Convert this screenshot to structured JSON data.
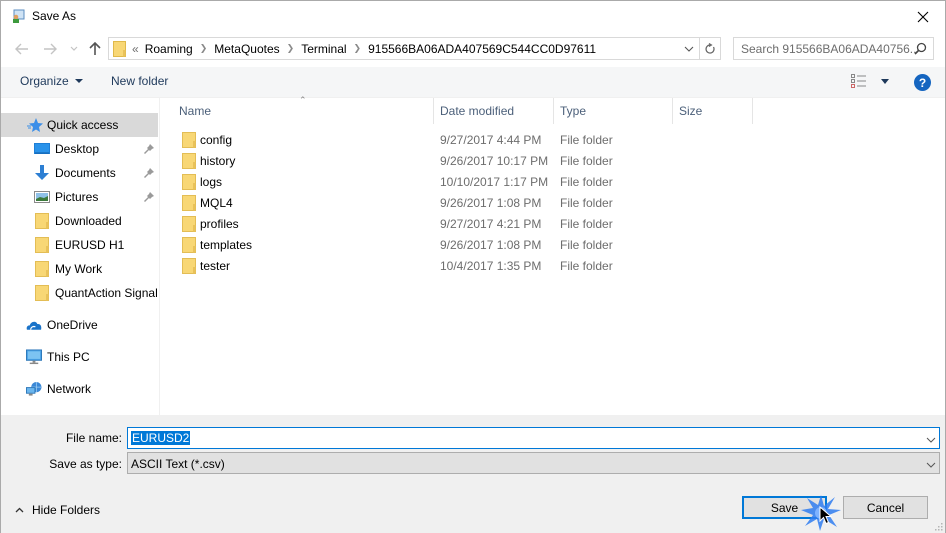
{
  "window": {
    "title": "Save As",
    "close_label": "Close"
  },
  "navigation": {
    "back_label": "Back",
    "forward_label": "Forward",
    "recent_label": "Recent locations",
    "up_label": "Up",
    "breadcrumb_overflow": "«",
    "breadcrumbs": [
      "Roaming",
      "MetaQuotes",
      "Terminal",
      "915566BA06ADA407569C544CC0D97611"
    ],
    "search_placeholder": "Search 915566BA06ADA40756..."
  },
  "toolbar": {
    "organize_label": "Organize",
    "new_folder_label": "New folder",
    "help_label": "?"
  },
  "sidebar": {
    "items": [
      {
        "label": "Quick access",
        "icon": "star-icon",
        "selected": true,
        "pinned": false
      },
      {
        "label": "Desktop",
        "icon": "desktop-icon",
        "selected": false,
        "pinned": true
      },
      {
        "label": "Documents",
        "icon": "download-arrow-icon",
        "selected": false,
        "pinned": true
      },
      {
        "label": "Pictures",
        "icon": "pictures-icon",
        "selected": false,
        "pinned": true
      },
      {
        "label": "Downloaded",
        "icon": "folder-icon",
        "selected": false,
        "pinned": false
      },
      {
        "label": "EURUSD H1",
        "icon": "folder-icon",
        "selected": false,
        "pinned": false
      },
      {
        "label": "My Work",
        "icon": "folder-icon",
        "selected": false,
        "pinned": false
      },
      {
        "label": "QuantAction Signal",
        "icon": "folder-icon",
        "selected": false,
        "pinned": false
      },
      {
        "label": "OneDrive",
        "icon": "cloud-icon",
        "selected": false,
        "pinned": false
      },
      {
        "label": "This PC",
        "icon": "computer-icon",
        "selected": false,
        "pinned": false
      },
      {
        "label": "Network",
        "icon": "network-icon",
        "selected": false,
        "pinned": false
      }
    ]
  },
  "filelist": {
    "columns": [
      "Name",
      "Date modified",
      "Type",
      "Size"
    ],
    "rows": [
      {
        "name": "config",
        "date": "9/27/2017 4:44 PM",
        "type": "File folder",
        "size": ""
      },
      {
        "name": "history",
        "date": "9/26/2017 10:17 PM",
        "type": "File folder",
        "size": ""
      },
      {
        "name": "logs",
        "date": "10/10/2017 1:17 PM",
        "type": "File folder",
        "size": ""
      },
      {
        "name": "MQL4",
        "date": "9/26/2017 1:08 PM",
        "type": "File folder",
        "size": ""
      },
      {
        "name": "profiles",
        "date": "9/27/2017 4:21 PM",
        "type": "File folder",
        "size": ""
      },
      {
        "name": "templates",
        "date": "9/26/2017 1:08 PM",
        "type": "File folder",
        "size": ""
      },
      {
        "name": "tester",
        "date": "10/4/2017 1:35 PM",
        "type": "File folder",
        "size": ""
      }
    ]
  },
  "form": {
    "file_name_label": "File name:",
    "file_name_value": "EURUSD2",
    "save_type_label": "Save as type:",
    "save_type_value": "ASCII Text (*.csv)",
    "hide_folders_label": "Hide Folders",
    "save_label": "Save",
    "cancel_label": "Cancel"
  },
  "colors": {
    "accent": "#0078d7",
    "selection_bg": "#d9d9d9",
    "folder_yellow": "#f8d775",
    "help_blue": "#1565c0"
  }
}
